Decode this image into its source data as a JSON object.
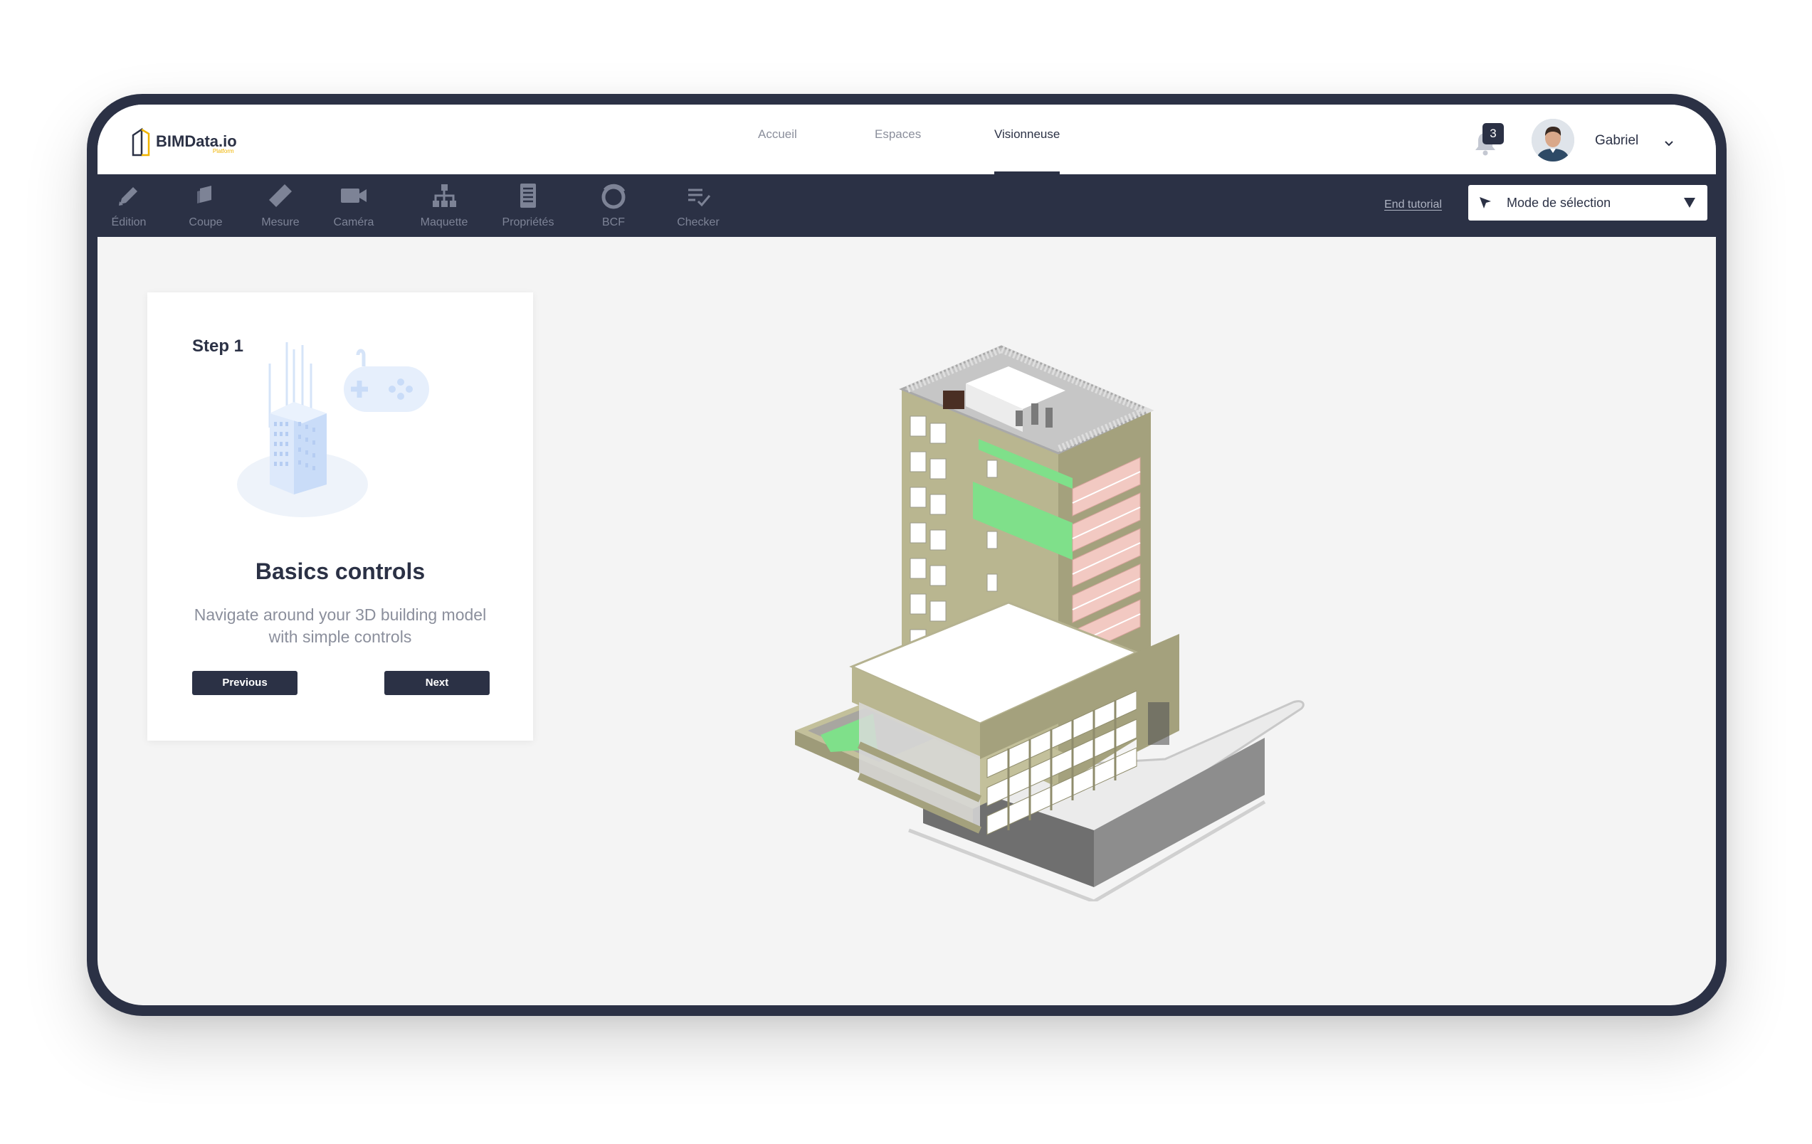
{
  "header": {
    "logo_text": "BIMData.io",
    "logo_sub": "Platform",
    "nav": [
      {
        "label": "Accueil"
      },
      {
        "label": "Espaces"
      },
      {
        "label": "Visionneuse",
        "active": true
      }
    ],
    "notifications_count": "3",
    "user_name": "Gabriel"
  },
  "toolbar": {
    "tools": [
      {
        "label": "Édition",
        "icon": "pencil-icon"
      },
      {
        "label": "Coupe",
        "icon": "section-icon"
      },
      {
        "label": "Mesure",
        "icon": "ruler-icon"
      },
      {
        "label": "Caméra",
        "icon": "camera-icon"
      },
      {
        "label": "Maquette",
        "icon": "hierarchy-icon"
      },
      {
        "label": "Propriétés",
        "icon": "document-icon"
      },
      {
        "label": "BCF",
        "icon": "bcf-icon"
      },
      {
        "label": "Checker",
        "icon": "checklist-icon"
      }
    ],
    "end_tutorial": "End tutorial",
    "mode_select": "Mode de sélection"
  },
  "tutorial": {
    "step": "Step 1",
    "title": "Basics controls",
    "description": "Navigate around your 3D building model with simple controls",
    "previous": "Previous",
    "next": "Next"
  },
  "colors": {
    "navy": "#2b3145",
    "canvas": "#f4f4f4",
    "building_wall": "#b8b58f",
    "highlight_green": "#7fe08a"
  }
}
